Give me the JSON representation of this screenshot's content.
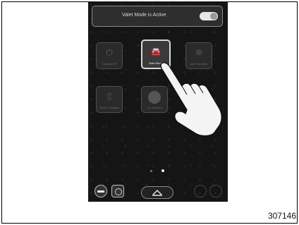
{
  "valet_bar": {
    "text": "Valet Mode is Active",
    "toggle_state": "on"
  },
  "tiles": [
    {
      "label": "Display Off",
      "icon": "power-icon",
      "active": false
    },
    {
      "label": "Valet Mode",
      "icon": "valet-car-icon",
      "active": true
    },
    {
      "label": "Add Favorites",
      "icon": "add-icon",
      "active": false
    },
    {
      "label": "Vehicle Settings",
      "icon": "phone-icon",
      "active": false
    },
    {
      "label": "Car Camera",
      "icon": "camera-icon",
      "active": false
    }
  ],
  "page_indicator": {
    "current": 2,
    "total": 2
  },
  "figure_number": "307146",
  "colors": {
    "screen_bg": "#151515",
    "active_tile_border": "#d9d9d9"
  }
}
